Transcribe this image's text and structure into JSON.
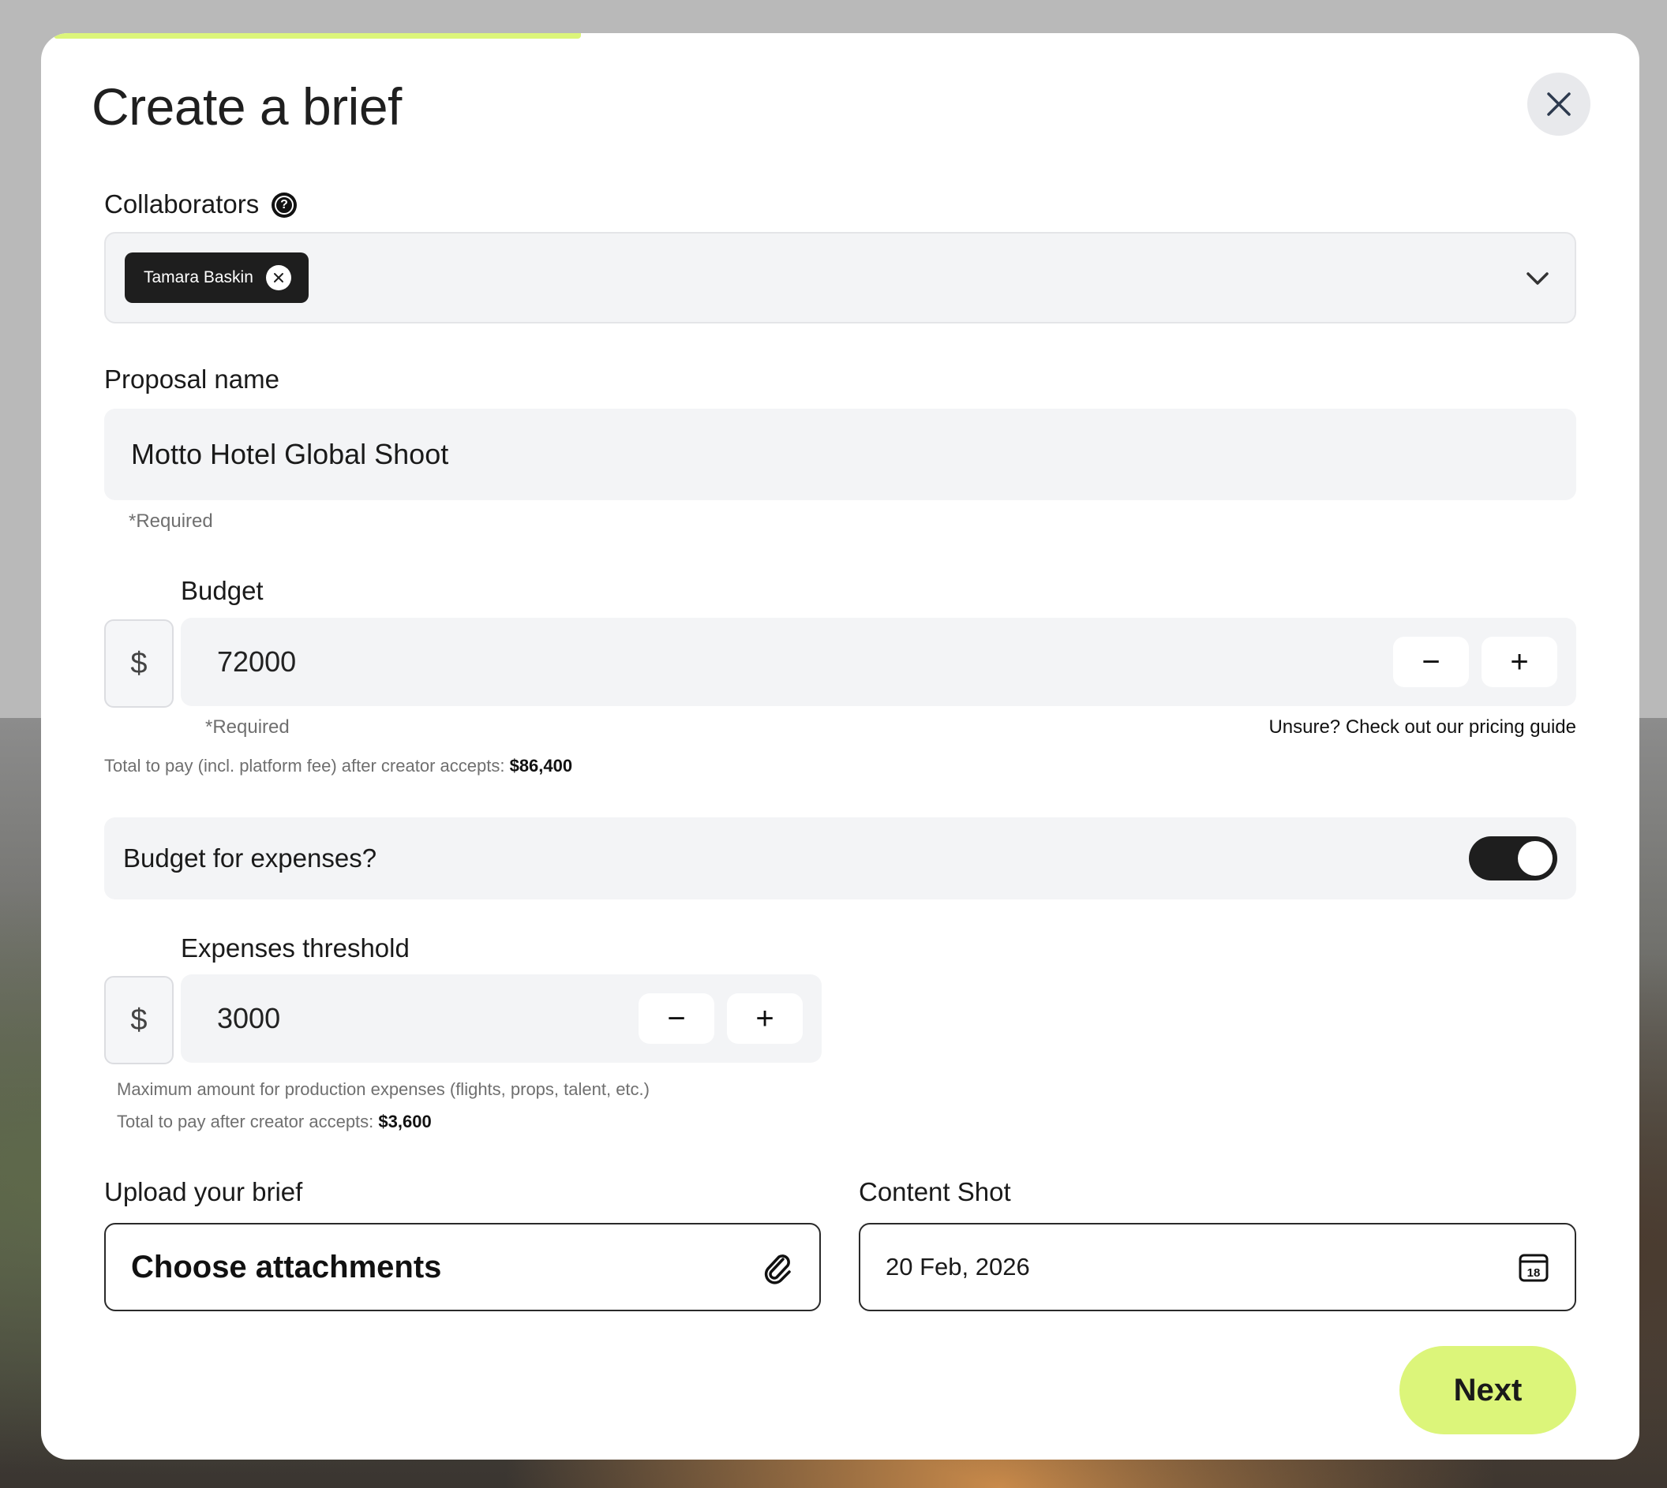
{
  "modal": {
    "title": "Create a brief",
    "progress_percent": 33,
    "accent_color": "#dcf57a"
  },
  "collaborators": {
    "label": "Collaborators",
    "help_icon": "question-circle-icon",
    "selected": [
      "Tamara Baskin"
    ]
  },
  "proposal_name": {
    "label": "Proposal name",
    "value": "Motto Hotel Global Shoot",
    "required_text": "*Required"
  },
  "budget": {
    "label": "Budget",
    "currency_symbol": "$",
    "value": "72000",
    "decrement_label": "−",
    "increment_label": "+",
    "required_text": "*Required",
    "pricing_link": "Unsure? Check out our pricing guide",
    "total_text": "Total to pay (incl. platform fee) after creator accepts:",
    "total_value": "$86,400"
  },
  "expenses_toggle": {
    "label": "Budget for expenses?",
    "enabled": true
  },
  "expenses_threshold": {
    "label": "Expenses threshold",
    "currency_symbol": "$",
    "value": "3000",
    "decrement_label": "−",
    "increment_label": "+",
    "helper_text": "Maximum amount for production expenses (flights, props, talent, etc.)",
    "total_text": "Total to pay after creator accepts:",
    "total_value": "$3,600"
  },
  "upload": {
    "label": "Upload your brief",
    "button_text": "Choose attachments",
    "icon": "paperclip-icon"
  },
  "content_shot": {
    "label": "Content Shot",
    "value": "20 Feb, 2026",
    "icon": "calendar-icon",
    "calendar_day": "18"
  },
  "footer": {
    "next_label": "Next"
  }
}
